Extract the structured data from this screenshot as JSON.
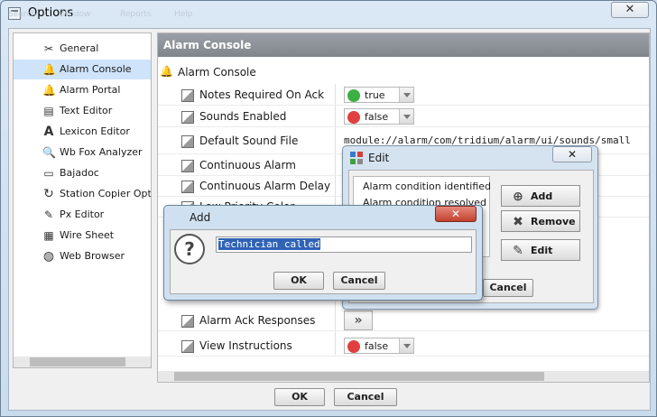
{
  "window": {
    "title": "Options",
    "close_glyph": "✕",
    "ghost_menu": [
      "Search",
      "Window",
      "Reports",
      "Help"
    ]
  },
  "nav": {
    "items": [
      {
        "label": "General",
        "icon": "wrench-icon",
        "glyph": "✂"
      },
      {
        "label": "Alarm Console",
        "icon": "bell-icon",
        "glyph": "🔔",
        "selected": true
      },
      {
        "label": "Alarm Portal",
        "icon": "bell-icon",
        "glyph": "🔔"
      },
      {
        "label": "Text Editor",
        "icon": "document-icon",
        "glyph": "▤"
      },
      {
        "label": "Lexicon Editor",
        "icon": "letter-a-icon",
        "glyph": "A"
      },
      {
        "label": "Wb Fox Analyzer",
        "icon": "magnifier-icon",
        "glyph": "🔍"
      },
      {
        "label": "Bajadoc",
        "icon": "folder-icon",
        "glyph": "▭"
      },
      {
        "label": "Station Copier Optio",
        "icon": "refresh-icon",
        "glyph": "↻"
      },
      {
        "label": "Px Editor",
        "icon": "pencil-icon",
        "glyph": "✎"
      },
      {
        "label": "Wire Sheet",
        "icon": "sheet-icon",
        "glyph": "▦"
      },
      {
        "label": "Web Browser",
        "icon": "globe-icon",
        "glyph": "◍"
      }
    ]
  },
  "panel": {
    "header": "Alarm Console",
    "section_label": "Alarm Console",
    "rows": {
      "notes_required": {
        "label": "Notes Required On Ack",
        "value": "true",
        "color": "#3cb043"
      },
      "sounds_enabled": {
        "label": "Sounds Enabled",
        "value": "false",
        "color": "#e04040"
      },
      "default_sound": {
        "label": "Default Sound File",
        "value": "module://alarm/com/tridium/alarm/ui/sounds/small"
      },
      "continuous_alarm": {
        "label": "Continuous Alarm"
      },
      "continuous_delay": {
        "label": "Continuous Alarm Delay"
      },
      "low_priority": {
        "label": "Low Priority Color"
      },
      "ack_responses": {
        "label": "Alarm Ack Responses",
        "button_glyph": "»"
      },
      "view_instructions": {
        "label": "View Instructions",
        "value": "false",
        "color": "#e04040"
      }
    }
  },
  "footer": {
    "ok": "OK",
    "cancel": "Cancel"
  },
  "edit_dialog": {
    "title": "Edit",
    "close_glyph": "✕",
    "list": [
      "Alarm condition identified",
      "Alarm condition resolved"
    ],
    "add_label": "Add",
    "add_glyph": "⊕",
    "remove_label": "Remove",
    "remove_glyph": "✖",
    "edit_label": "Edit",
    "edit_glyph": "✎",
    "cancel_label": "Cancel"
  },
  "add_dialog": {
    "title": "Add",
    "close_glyph": "✕",
    "question_glyph": "?",
    "input_value": "Technician called",
    "ok": "OK",
    "cancel": "Cancel"
  }
}
